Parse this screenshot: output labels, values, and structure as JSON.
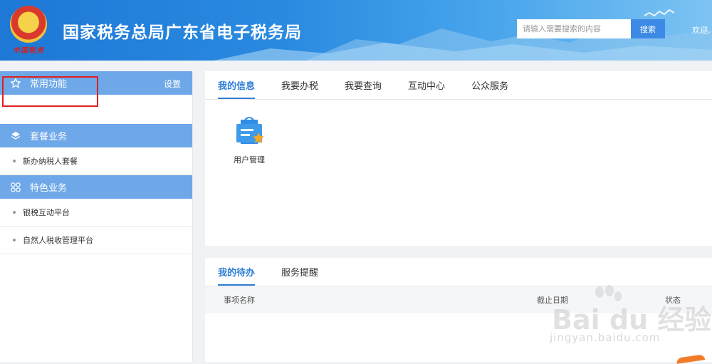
{
  "header": {
    "emblem_text": "中国税务",
    "title": "国家税务总局广东省电子税务局",
    "search_placeholder": "请输入需要搜索的内容",
    "search_button": "搜索",
    "welcome": "欢迎,"
  },
  "sidebar": {
    "common": {
      "label": "常用功能",
      "settings": "设置"
    },
    "package": {
      "label": "套餐业务",
      "items": [
        "新办纳税人套餐"
      ]
    },
    "featured": {
      "label": "特色业务",
      "items": [
        "银税互动平台",
        "自然人税收管理平台"
      ]
    }
  },
  "info_panel": {
    "tabs": [
      "我的信息",
      "我要办税",
      "我要查询",
      "互动中心",
      "公众服务"
    ],
    "active_tab": 0,
    "apps": [
      {
        "label": "用户管理",
        "icon": "user-card-icon"
      }
    ]
  },
  "todo_panel": {
    "tabs": [
      "我的待办",
      "服务提醒"
    ],
    "active_tab": 0,
    "columns": [
      "事项名称",
      "截止日期",
      "状态"
    ]
  },
  "watermark": {
    "text": "Bai du 经验",
    "url": "jingyan.baidu.com"
  },
  "colors": {
    "accent": "#2f7ed8",
    "sidebar_header": "#6ea8e8",
    "highlight": "#e02020"
  }
}
